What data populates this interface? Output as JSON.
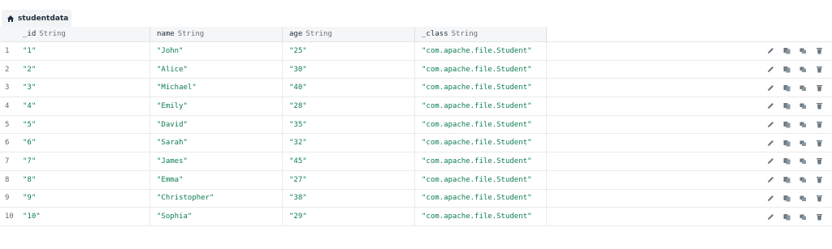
{
  "collection_tab": {
    "label": "studentdata",
    "icon": "home-icon"
  },
  "columns": [
    {
      "field": "_id",
      "type": "String"
    },
    {
      "field": "name",
      "type": "String"
    },
    {
      "field": "age",
      "type": "String"
    },
    {
      "field": "_class",
      "type": "String"
    }
  ],
  "rows": [
    {
      "num": "1",
      "id": "\"1\"",
      "name": "\"John\"",
      "age": "\"25\"",
      "class": "\"com.apache.file.Student\""
    },
    {
      "num": "2",
      "id": "\"2\"",
      "name": "\"Alice\"",
      "age": "\"30\"",
      "class": "\"com.apache.file.Student\""
    },
    {
      "num": "3",
      "id": "\"3\"",
      "name": "\"Michael\"",
      "age": "\"40\"",
      "class": "\"com.apache.file.Student\""
    },
    {
      "num": "4",
      "id": "\"4\"",
      "name": "\"Emily\"",
      "age": "\"28\"",
      "class": "\"com.apache.file.Student\""
    },
    {
      "num": "5",
      "id": "\"5\"",
      "name": "\"David\"",
      "age": "\"35\"",
      "class": "\"com.apache.file.Student\""
    },
    {
      "num": "6",
      "id": "\"6\"",
      "name": "\"Sarah\"",
      "age": "\"32\"",
      "class": "\"com.apache.file.Student\""
    },
    {
      "num": "7",
      "id": "\"7\"",
      "name": "\"James\"",
      "age": "\"45\"",
      "class": "\"com.apache.file.Student\""
    },
    {
      "num": "8",
      "id": "\"8\"",
      "name": "\"Emma\"",
      "age": "\"27\"",
      "class": "\"com.apache.file.Student\""
    },
    {
      "num": "9",
      "id": "\"9\"",
      "name": "\"Christopher\"",
      "age": "\"38\"",
      "class": "\"com.apache.file.Student\""
    },
    {
      "num": "10",
      "id": "\"10\"",
      "name": "\"Sophia\"",
      "age": "\"29\"",
      "class": "\"com.apache.file.Student\""
    }
  ],
  "row_actions": [
    "edit-icon",
    "copy-icon",
    "clone-icon",
    "delete-icon"
  ],
  "colors": {
    "value_green": "#0d7d4f",
    "icon_gray": "#6b7780",
    "header_bg": "#f5f6f7"
  }
}
